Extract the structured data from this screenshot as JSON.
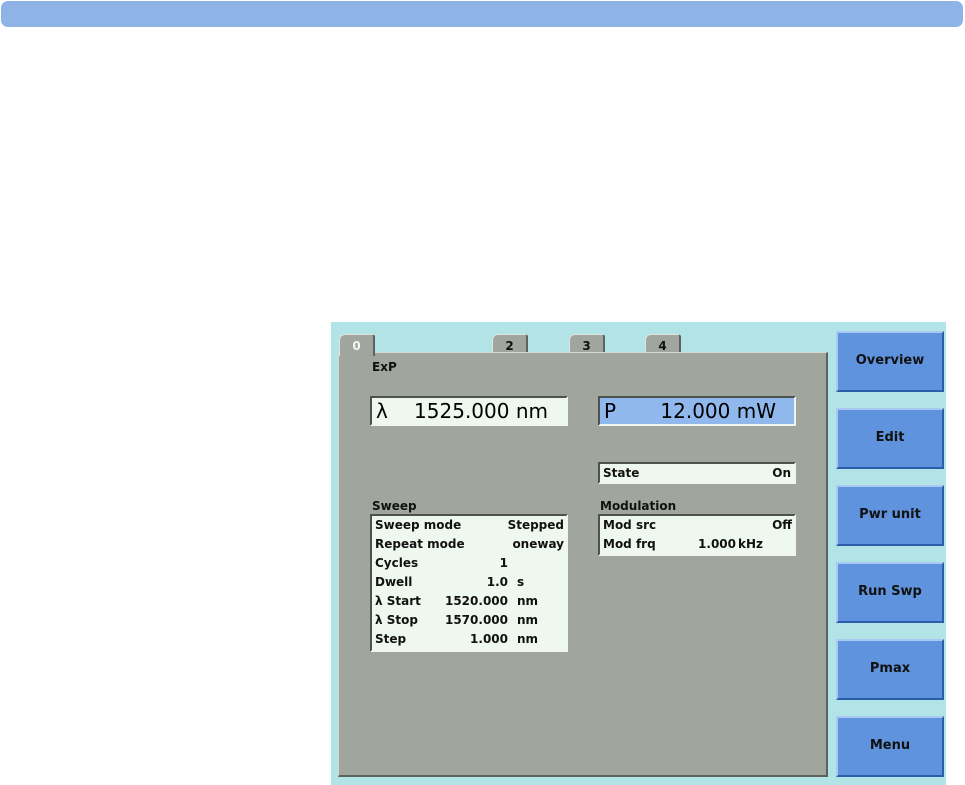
{
  "tabs": [
    {
      "label": "0",
      "active": true
    },
    {
      "label": "2",
      "active": false
    },
    {
      "label": "3",
      "active": false
    },
    {
      "label": "4",
      "active": false
    }
  ],
  "panel_title": "ExP",
  "wavelength": {
    "symbol": "λ",
    "value": "1525.000 nm"
  },
  "power": {
    "symbol": "P",
    "value": "12.000 mW"
  },
  "state": {
    "label": "State",
    "value": "On"
  },
  "sweep": {
    "title": "Sweep",
    "rows": [
      {
        "label": "Sweep mode",
        "value": "Stepped",
        "unit": ""
      },
      {
        "label": "Repeat mode",
        "value": "oneway",
        "unit": ""
      },
      {
        "label": "Cycles",
        "value": "1",
        "unit": ""
      },
      {
        "label": "Dwell",
        "value": "1.0",
        "unit": "s"
      },
      {
        "label": "λ Start",
        "value": "1520.000",
        "unit": "nm"
      },
      {
        "label": "λ Stop",
        "value": "1570.000",
        "unit": "nm"
      },
      {
        "label": "Step",
        "value": "1.000",
        "unit": "nm"
      }
    ]
  },
  "modulation": {
    "title": "Modulation",
    "rows": [
      {
        "label": "Mod src",
        "value": "Off",
        "unit": ""
      },
      {
        "label": "Mod frq",
        "value": "1.000",
        "unit": "kHz"
      }
    ]
  },
  "softkeys": [
    "Overview",
    "Edit",
    "Pwr unit",
    "Run Swp",
    "Pmax",
    "Menu"
  ],
  "colors": {
    "topbar": "#8fb3e6",
    "instrument_bg": "#b2e3e6",
    "panel_bg": "#a0a59e",
    "field_bg": "#eef8ee",
    "power_field_bg": "#90b8ec",
    "softkey_bg": "#5f93de"
  }
}
